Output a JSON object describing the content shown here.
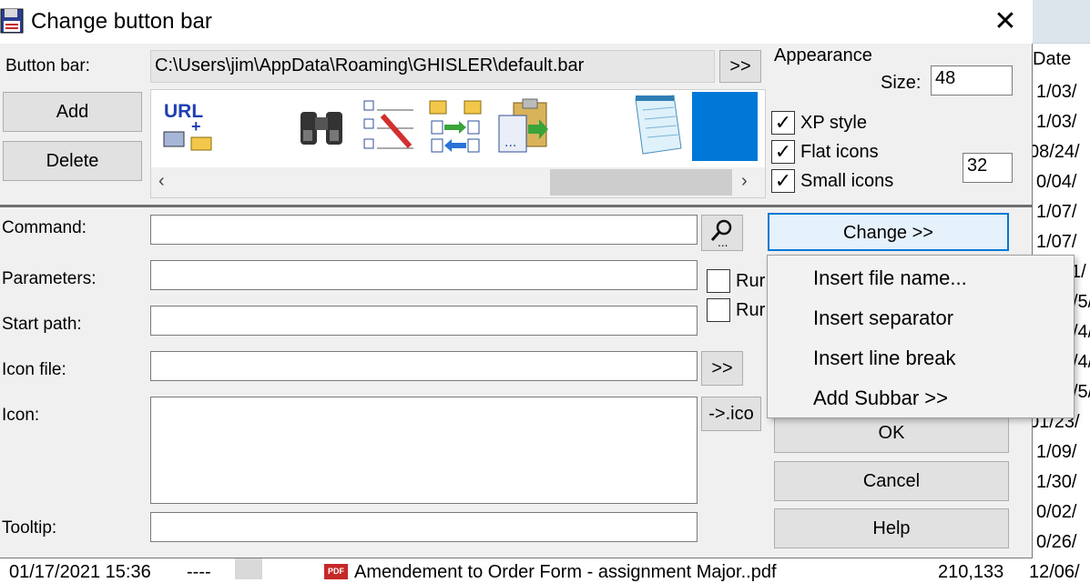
{
  "window": {
    "title": "Change button bar",
    "close_glyph": "✕"
  },
  "button_bar": {
    "label": "Button bar:",
    "path": "C:\\Users\\jim\\AppData\\Roaming\\GHISLER\\default.bar",
    "browse_label": ">>"
  },
  "buttons": {
    "add": "Add",
    "delete": "Delete",
    "change": "Change >>",
    "ok": "OK",
    "cancel": "Cancel",
    "help": "Help",
    "icon_file_browse": ">>",
    "to_ico": "->.ico"
  },
  "toolbar_icons": {
    "url_text": "URL",
    "icons": [
      "url-connect-icon",
      "binoculars-icon",
      "edit-list-icon",
      "sync-folders-icon",
      "paste-file-icon",
      "notepad-icon",
      "blue-square-icon"
    ]
  },
  "appearance": {
    "heading": "Appearance",
    "size_label": "Size:",
    "size_value": "48",
    "xp_style": "XP style",
    "flat_icons": "Flat icons",
    "small_icons": "Small icons",
    "small_size_value": "32",
    "checked_mark": "✓"
  },
  "fields": {
    "command": "Command:",
    "parameters": "Parameters:",
    "start_path": "Start path:",
    "icon_file": "Icon file:",
    "icon": "Icon:",
    "tooltip": "Tooltip:",
    "run1": "Rur",
    "run2": "Rur"
  },
  "menu": {
    "items": [
      "Insert file name...",
      "Insert separator",
      "Insert line break",
      "Add Subbar >>"
    ]
  },
  "background": {
    "date_header": "Date",
    "dates": [
      "1/03/",
      "1/03/",
      "08/24/",
      "0/04/",
      "1/07/",
      "1/07/",
      "1/",
      "/5/",
      "/4/",
      "/4/",
      "/5/",
      "01/23/",
      "1/09/",
      "1/30/",
      "0/02/",
      "0/26/"
    ],
    "status_datetime": "01/17/2021 15:36",
    "status_attr": "----",
    "pdf_icon_text": "PDF",
    "status_filename": "Amendement to Order Form - assignment Major..pdf",
    "status_size": "210,133",
    "status_date": "12/06/"
  }
}
